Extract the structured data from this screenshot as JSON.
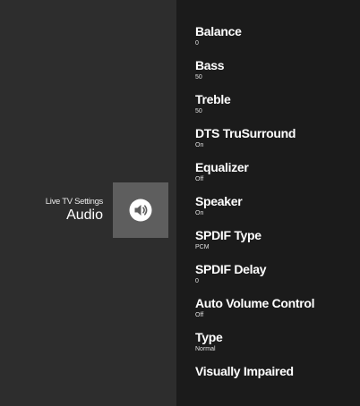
{
  "breadcrumb": {
    "parent": "Live TV Settings",
    "title": "Audio"
  },
  "tile": {
    "icon": "volume-icon"
  },
  "settings": [
    {
      "label": "Balance",
      "value": "0"
    },
    {
      "label": "Bass",
      "value": "50"
    },
    {
      "label": "Treble",
      "value": "50"
    },
    {
      "label": "DTS TruSurround",
      "value": "On"
    },
    {
      "label": "Equalizer",
      "value": "Off"
    },
    {
      "label": "Speaker",
      "value": "On"
    },
    {
      "label": "SPDIF Type",
      "value": "PCM"
    },
    {
      "label": "SPDIF Delay",
      "value": "0"
    },
    {
      "label": "Auto Volume Control",
      "value": "Off"
    },
    {
      "label": "Type",
      "value": "Normal"
    },
    {
      "label": "Visually Impaired",
      "value": ""
    }
  ],
  "colors": {
    "left_pane": "#2d2d2d",
    "right_pane": "#1b1b1b",
    "tile": "#5e5e5e",
    "text": "#ffffff"
  }
}
